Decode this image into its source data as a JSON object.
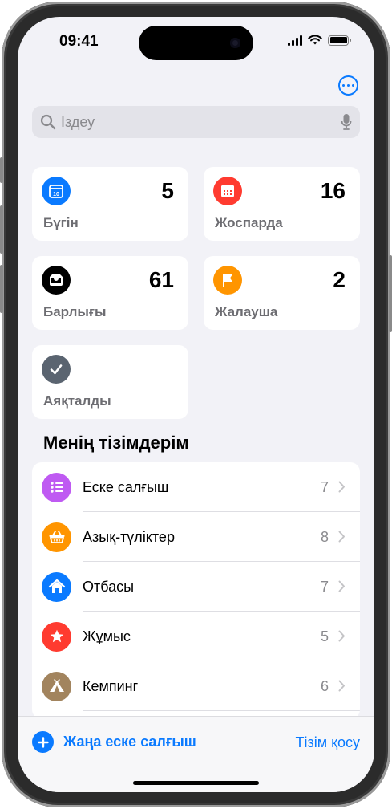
{
  "status_bar": {
    "time": "09:41"
  },
  "search": {
    "placeholder": "Іздеу"
  },
  "tiles": [
    {
      "label": "Бүгін",
      "count": "5",
      "icon": "calendar-today-icon",
      "color": "#0a7aff",
      "day": "10"
    },
    {
      "label": "Жоспарда",
      "count": "16",
      "icon": "calendar-grid-icon",
      "color": "#ff3b30"
    },
    {
      "label": "Барлығы",
      "count": "61",
      "icon": "tray-icon",
      "color": "#000000"
    },
    {
      "label": "Жалауша",
      "count": "2",
      "icon": "flag-icon",
      "color": "#ff9500"
    },
    {
      "label": "Аяқталды",
      "count": "",
      "icon": "checkmark-icon",
      "color": "#5a6470"
    }
  ],
  "my_lists": {
    "title": "Менің тізімдерім",
    "items": [
      {
        "label": "Еске салғыш",
        "count": "7",
        "icon": "list-bullet-icon",
        "color": "#bf5af2"
      },
      {
        "label": "Азық-түліктер",
        "count": "8",
        "icon": "basket-icon",
        "color": "#ff9500"
      },
      {
        "label": "Отбасы",
        "count": "7",
        "icon": "house-icon",
        "color": "#0a7aff"
      },
      {
        "label": "Жұмыс",
        "count": "5",
        "icon": "star-icon",
        "color": "#ff3b30"
      },
      {
        "label": "Кемпинг",
        "count": "6",
        "icon": "tent-icon",
        "color": "#a2845e"
      }
    ]
  },
  "toolbar": {
    "new_reminder": "Жаңа еске салғыш",
    "add_list": "Тізім қосу"
  },
  "colors": {
    "accent": "#0a7aff",
    "background": "#f2f2f7"
  }
}
